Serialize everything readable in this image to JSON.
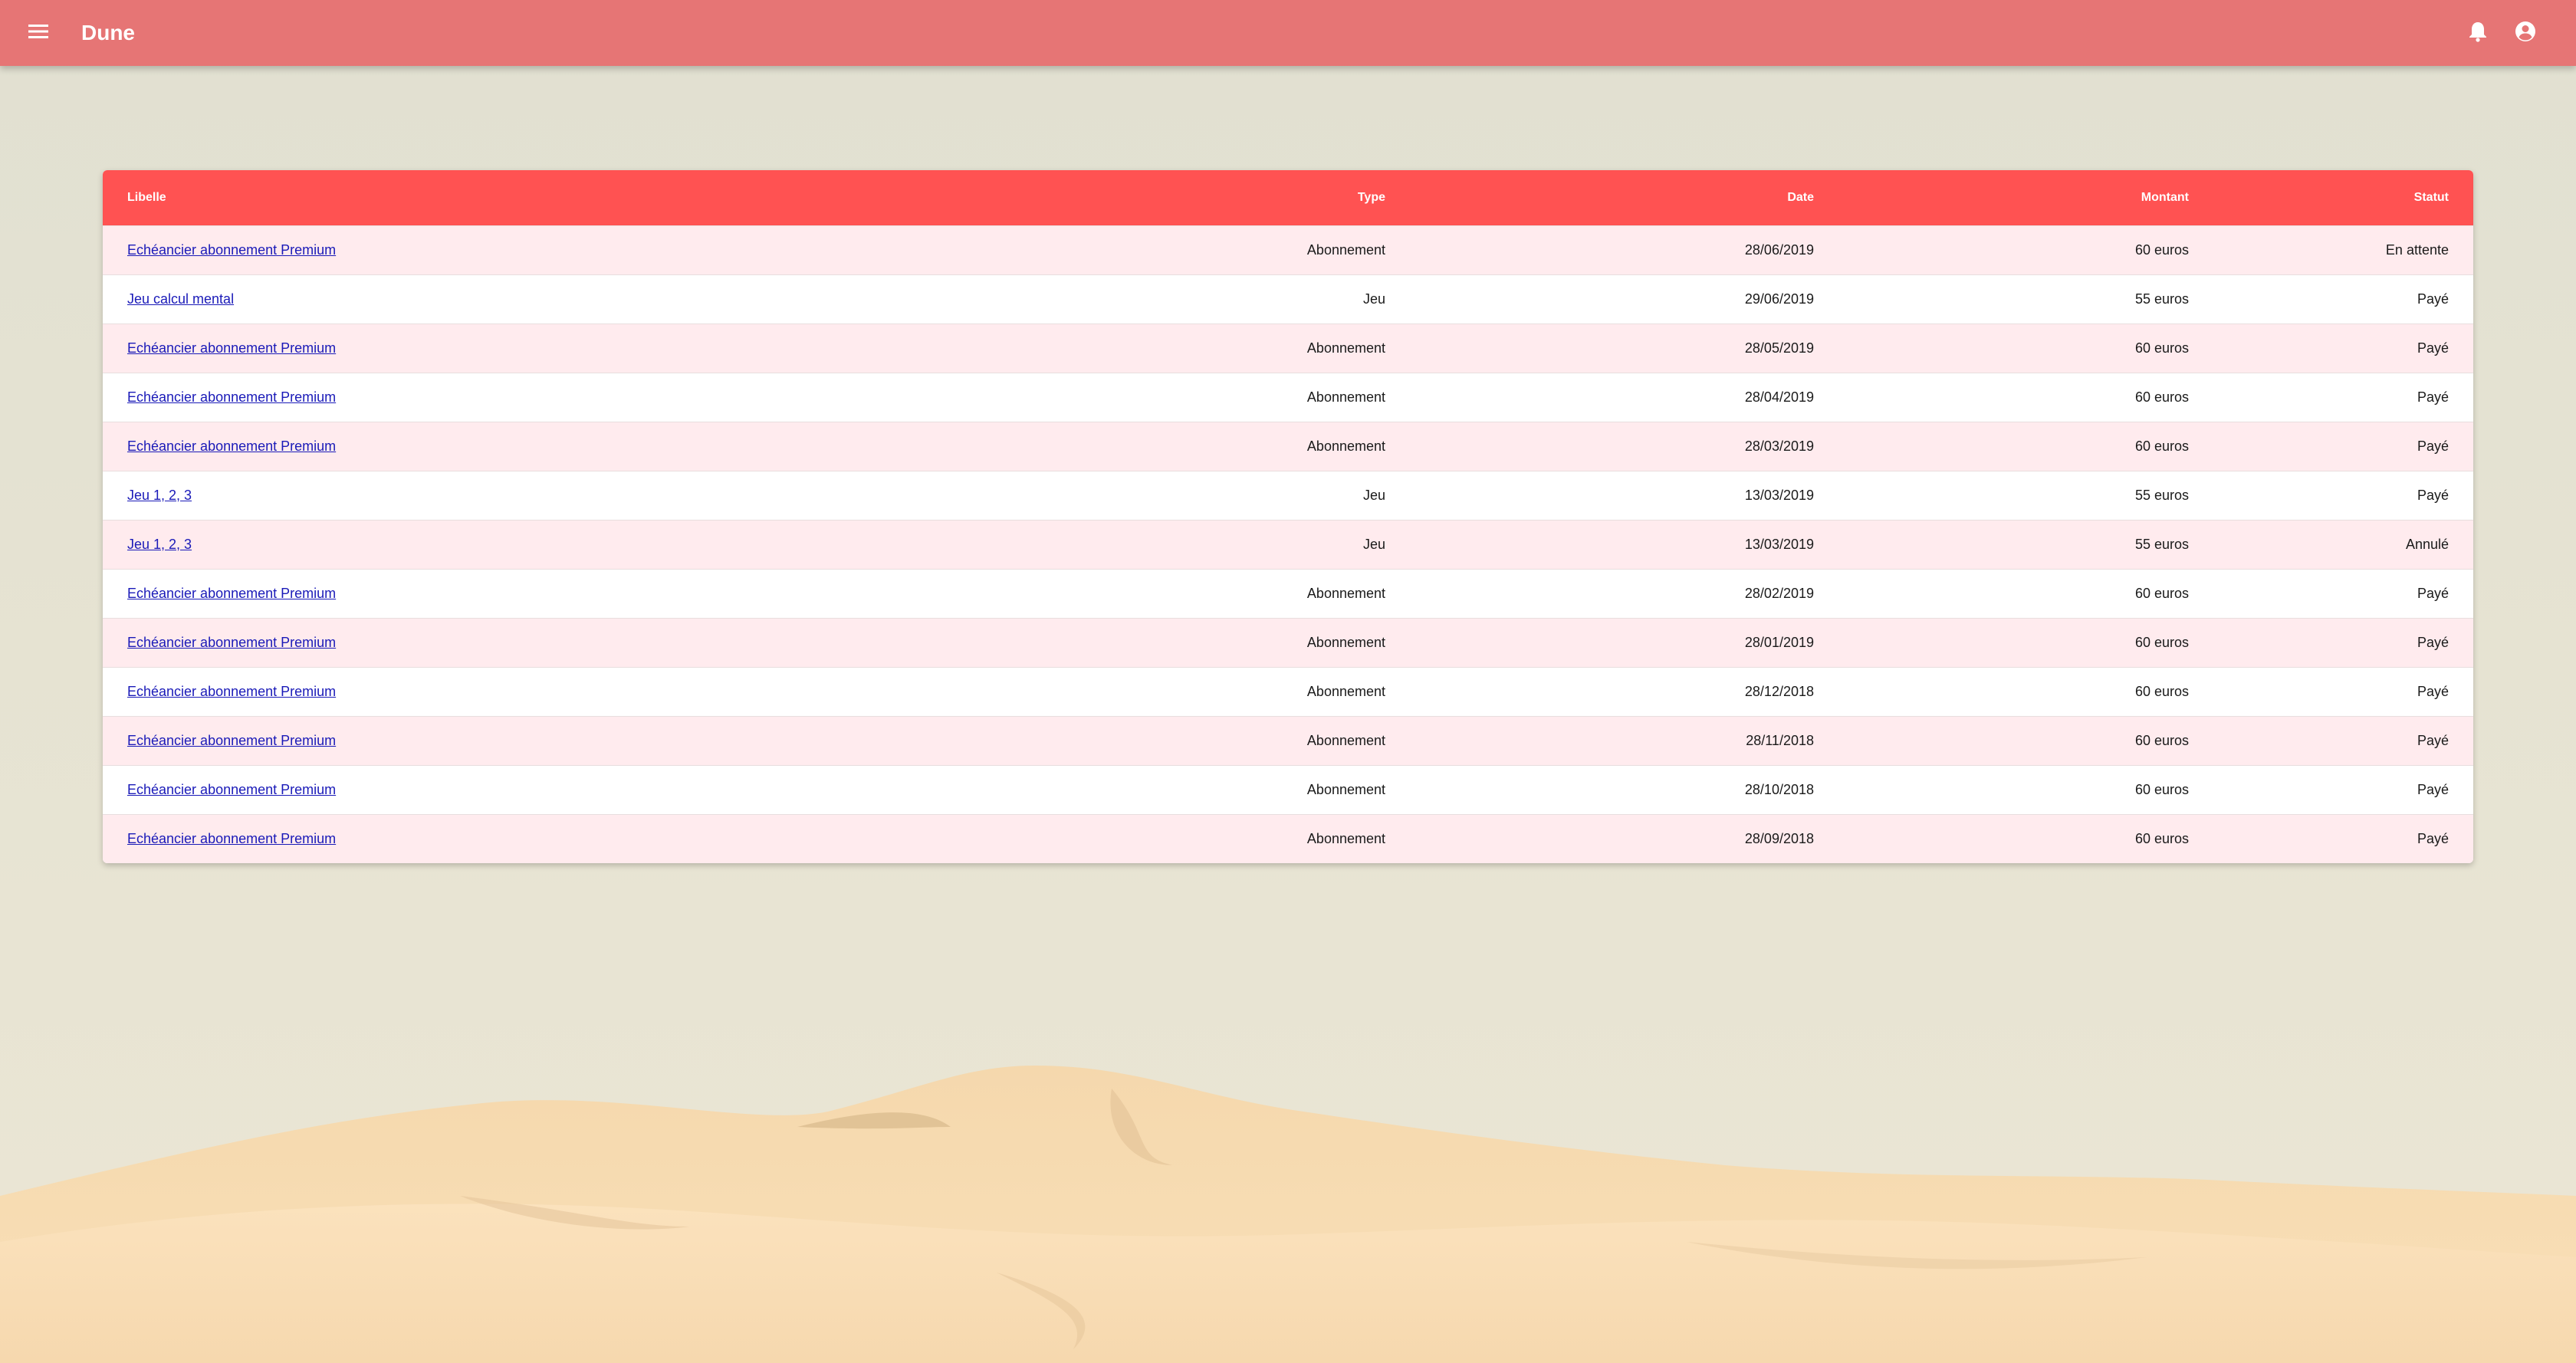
{
  "app": {
    "title": "Dune",
    "menu_icon": "menu-icon",
    "bell_icon": "bell-icon",
    "account_icon": "account-circle-icon"
  },
  "colors": {
    "app_bar": "#e67575",
    "table_header": "#ff5252",
    "row_alt": "#ffebee",
    "link": "#1a1ab8"
  },
  "table": {
    "columns": [
      "Libelle",
      "Type",
      "Date",
      "Montant",
      "Statut"
    ],
    "rows": [
      {
        "libelle": "Echéancier abonnement Premium",
        "type": "Abonnement",
        "date": "28/06/2019",
        "montant": "60 euros",
        "statut": "En attente"
      },
      {
        "libelle": "Jeu calcul mental",
        "type": "Jeu",
        "date": "29/06/2019",
        "montant": "55 euros",
        "statut": "Payé"
      },
      {
        "libelle": "Echéancier abonnement Premium",
        "type": "Abonnement",
        "date": "28/05/2019",
        "montant": "60 euros",
        "statut": "Payé"
      },
      {
        "libelle": "Echéancier abonnement Premium",
        "type": "Abonnement",
        "date": "28/04/2019",
        "montant": "60 euros",
        "statut": "Payé"
      },
      {
        "libelle": "Echéancier abonnement Premium",
        "type": "Abonnement",
        "date": "28/03/2019",
        "montant": "60 euros",
        "statut": "Payé"
      },
      {
        "libelle": "Jeu 1, 2, 3",
        "type": "Jeu",
        "date": "13/03/2019",
        "montant": "55 euros",
        "statut": "Payé"
      },
      {
        "libelle": "Jeu 1, 2, 3",
        "type": "Jeu",
        "date": "13/03/2019",
        "montant": "55 euros",
        "statut": "Annulé"
      },
      {
        "libelle": "Echéancier abonnement Premium",
        "type": "Abonnement",
        "date": "28/02/2019",
        "montant": "60 euros",
        "statut": "Payé"
      },
      {
        "libelle": "Echéancier abonnement Premium",
        "type": "Abonnement",
        "date": "28/01/2019",
        "montant": "60 euros",
        "statut": "Payé"
      },
      {
        "libelle": "Echéancier abonnement Premium",
        "type": "Abonnement",
        "date": "28/12/2018",
        "montant": "60 euros",
        "statut": "Payé"
      },
      {
        "libelle": "Echéancier abonnement Premium",
        "type": "Abonnement",
        "date": "28/11/2018",
        "montant": "60 euros",
        "statut": "Payé"
      },
      {
        "libelle": "Echéancier abonnement Premium",
        "type": "Abonnement",
        "date": "28/10/2018",
        "montant": "60 euros",
        "statut": "Payé"
      },
      {
        "libelle": "Echéancier abonnement Premium",
        "type": "Abonnement",
        "date": "28/09/2018",
        "montant": "60 euros",
        "statut": "Payé"
      }
    ]
  }
}
